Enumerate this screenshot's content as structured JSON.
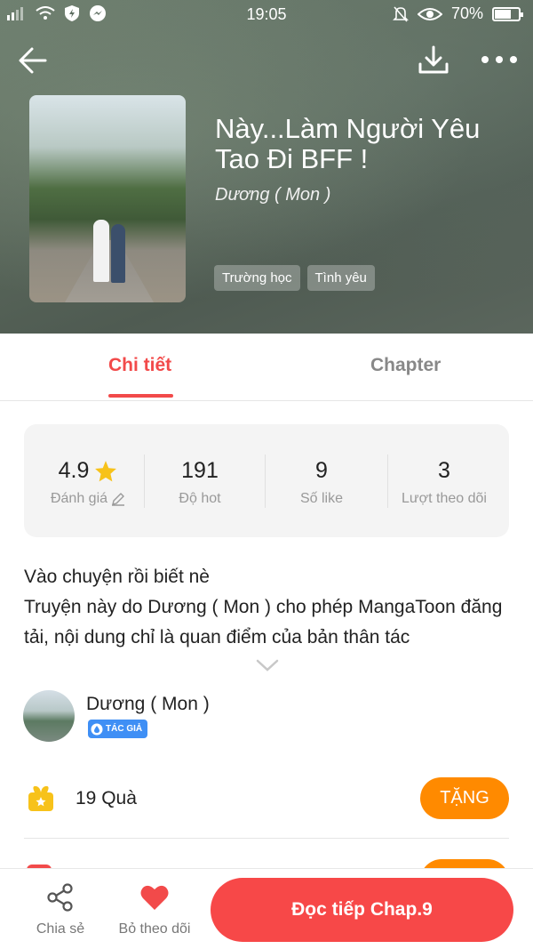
{
  "status_bar": {
    "time": "19:05",
    "battery_text": "70%",
    "battery_level": 0.7,
    "left_icons": [
      "signal-icon",
      "wifi-icon",
      "shield-icon",
      "messenger-icon"
    ],
    "right_icons": [
      "mute-icon",
      "eye-icon",
      "battery-icon"
    ]
  },
  "header": {
    "title": "Này...Làm Người Yêu Tao Đi BFF !",
    "author": "Dương ( Mon )",
    "tags": [
      "Trường học",
      "Tình yêu"
    ]
  },
  "tabs": [
    {
      "label": "Chi tiết",
      "active": true
    },
    {
      "label": "Chapter",
      "active": false
    }
  ],
  "stats": {
    "rating": {
      "value": "4.9",
      "label": "Đánh giá"
    },
    "hot": {
      "value": "191",
      "label": "Độ hot"
    },
    "likes": {
      "value": "9",
      "label": "Số like"
    },
    "followers": {
      "value": "3",
      "label": "Lượt theo dõi"
    }
  },
  "description": {
    "line1": "Vào chuyện rồi biết nè",
    "line2": "Truyện này do Dương ( Mon ) cho phép MangaToon đăng tải, nội dung chỉ là quan điểm của bản thân tác"
  },
  "author_section": {
    "name": "Dương ( Mon )",
    "badge": "TÁC GIẢ"
  },
  "gifts": {
    "count_text": "19 Quà",
    "button": "TẶNG"
  },
  "bottom_bar": {
    "share_label": "Chia sẻ",
    "follow_label": "Bỏ theo dõi",
    "read_button": "Đọc tiếp Chap.9"
  },
  "colors": {
    "accent_red": "#f24a4a",
    "orange": "#ff8a00",
    "star": "#f7c21a",
    "badge_blue": "#3f8ff5"
  }
}
